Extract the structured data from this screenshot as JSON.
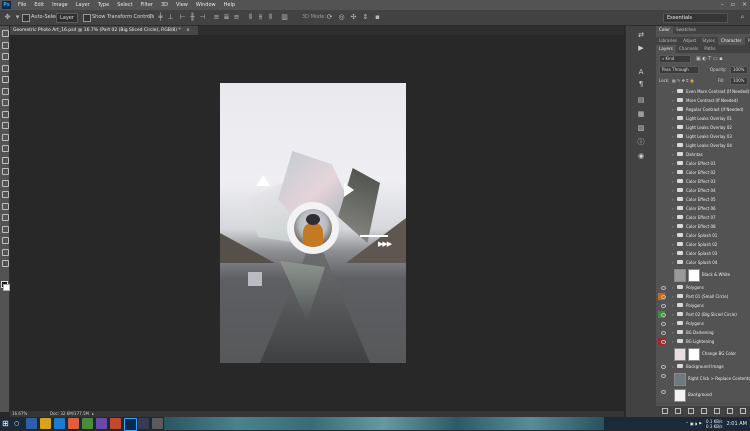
{
  "app": {
    "logo": "Ps",
    "menu": [
      "File",
      "Edit",
      "Image",
      "Layer",
      "Type",
      "Select",
      "Filter",
      "3D",
      "View",
      "Window",
      "Help"
    ]
  },
  "options_bar": {
    "auto_select_label": "Auto-Select:",
    "auto_select_value": "Layer",
    "transform_controls_label": "Show Transform Controls",
    "mode_3d_label": "3D Mode:",
    "workspace": "Essentials"
  },
  "document": {
    "tab_title": "Geometric Photo Art_16.psd @ 16.7% (Part 02 (Big Sliced Circle), RGB/8) *",
    "close": "×"
  },
  "status": {
    "zoom": "16.67%",
    "doc_size": "Doc: 32.6M/177.5M"
  },
  "panels": {
    "color_tabs": [
      "Color",
      "Swatches"
    ],
    "library_tabs": [
      "Libraries",
      "Adjust",
      "Styles",
      "Character",
      "Paragra"
    ],
    "layer_tabs": [
      "Layers",
      "Channels",
      "Paths"
    ],
    "kind_label": "Kind",
    "blend_mode": "Pass Through",
    "opacity_label": "Opacity:",
    "opacity_value": "100%",
    "lock_label": "Lock:",
    "fill_label": "Fill:",
    "fill_value": "100%"
  },
  "layers": [
    {
      "name": "Even More Contrast (If Needed)",
      "type": "group",
      "visible": false
    },
    {
      "name": "More Contrast (If Needed)",
      "type": "group",
      "visible": false
    },
    {
      "name": "Regular Contrast (If Needed)",
      "type": "group",
      "visible": false
    },
    {
      "name": "Light Leaks Overlay 01",
      "type": "group",
      "visible": false
    },
    {
      "name": "Light Leaks Overlay 02",
      "type": "group",
      "visible": false
    },
    {
      "name": "Light Leaks Overlay 03",
      "type": "group",
      "visible": false
    },
    {
      "name": "Light Leaks Overlay 04",
      "type": "group",
      "visible": false
    },
    {
      "name": "Dahntas",
      "type": "group",
      "visible": false
    },
    {
      "name": "Color Effect 01",
      "type": "group",
      "visible": false
    },
    {
      "name": "Color Effect 02",
      "type": "group",
      "visible": false
    },
    {
      "name": "Color Effect 03",
      "type": "group",
      "visible": false
    },
    {
      "name": "Color Effect 04",
      "type": "group",
      "visible": false
    },
    {
      "name": "Color Effect 05",
      "type": "group",
      "visible": false
    },
    {
      "name": "Color Effect 06",
      "type": "group",
      "visible": false
    },
    {
      "name": "Color Effect 07",
      "type": "group",
      "visible": false
    },
    {
      "name": "Color Effect 08",
      "type": "group",
      "visible": false
    },
    {
      "name": "Color Splash 01",
      "type": "group",
      "visible": false
    },
    {
      "name": "Color Splash 02",
      "type": "group",
      "visible": false
    },
    {
      "name": "Color Splash 03",
      "type": "group",
      "visible": false
    },
    {
      "name": "Color Splash 04",
      "type": "group",
      "visible": false
    },
    {
      "name": "Black & White",
      "type": "adjustment",
      "visible": false
    },
    {
      "name": "Polygons",
      "type": "group",
      "visible": true
    },
    {
      "name": "Part 01 (Small Circle)",
      "type": "group",
      "visible": true,
      "eye_color": "#c46a1a"
    },
    {
      "name": "Polygons",
      "type": "group",
      "visible": true
    },
    {
      "name": "Part 02 (Big Sliced Circle)",
      "type": "group",
      "visible": true,
      "eye_color": "#3d8f3d"
    },
    {
      "name": "Polygons",
      "type": "group",
      "visible": true
    },
    {
      "name": "BG Darkening",
      "type": "group",
      "visible": true
    },
    {
      "name": "BG Lightening",
      "type": "group",
      "visible": true,
      "eye_color": "#9c2a2a"
    },
    {
      "name": "Change BG Color",
      "type": "fill",
      "visible": false
    },
    {
      "name": "Background Image",
      "type": "group",
      "visible": true
    },
    {
      "name": "Right Click > Replace Contents",
      "type": "smart",
      "visible": true
    },
    {
      "name": "Background",
      "type": "background",
      "visible": true
    }
  ],
  "taskbar": {
    "clock_time": "2:01 AM",
    "net_up": "0.1 KB/s",
    "net_down": "0.3 KB/s"
  },
  "colors": {
    "menubar": "#535353",
    "canvas_bg": "#282828",
    "panel": "#535353",
    "taskbar": "#1b2a39"
  }
}
